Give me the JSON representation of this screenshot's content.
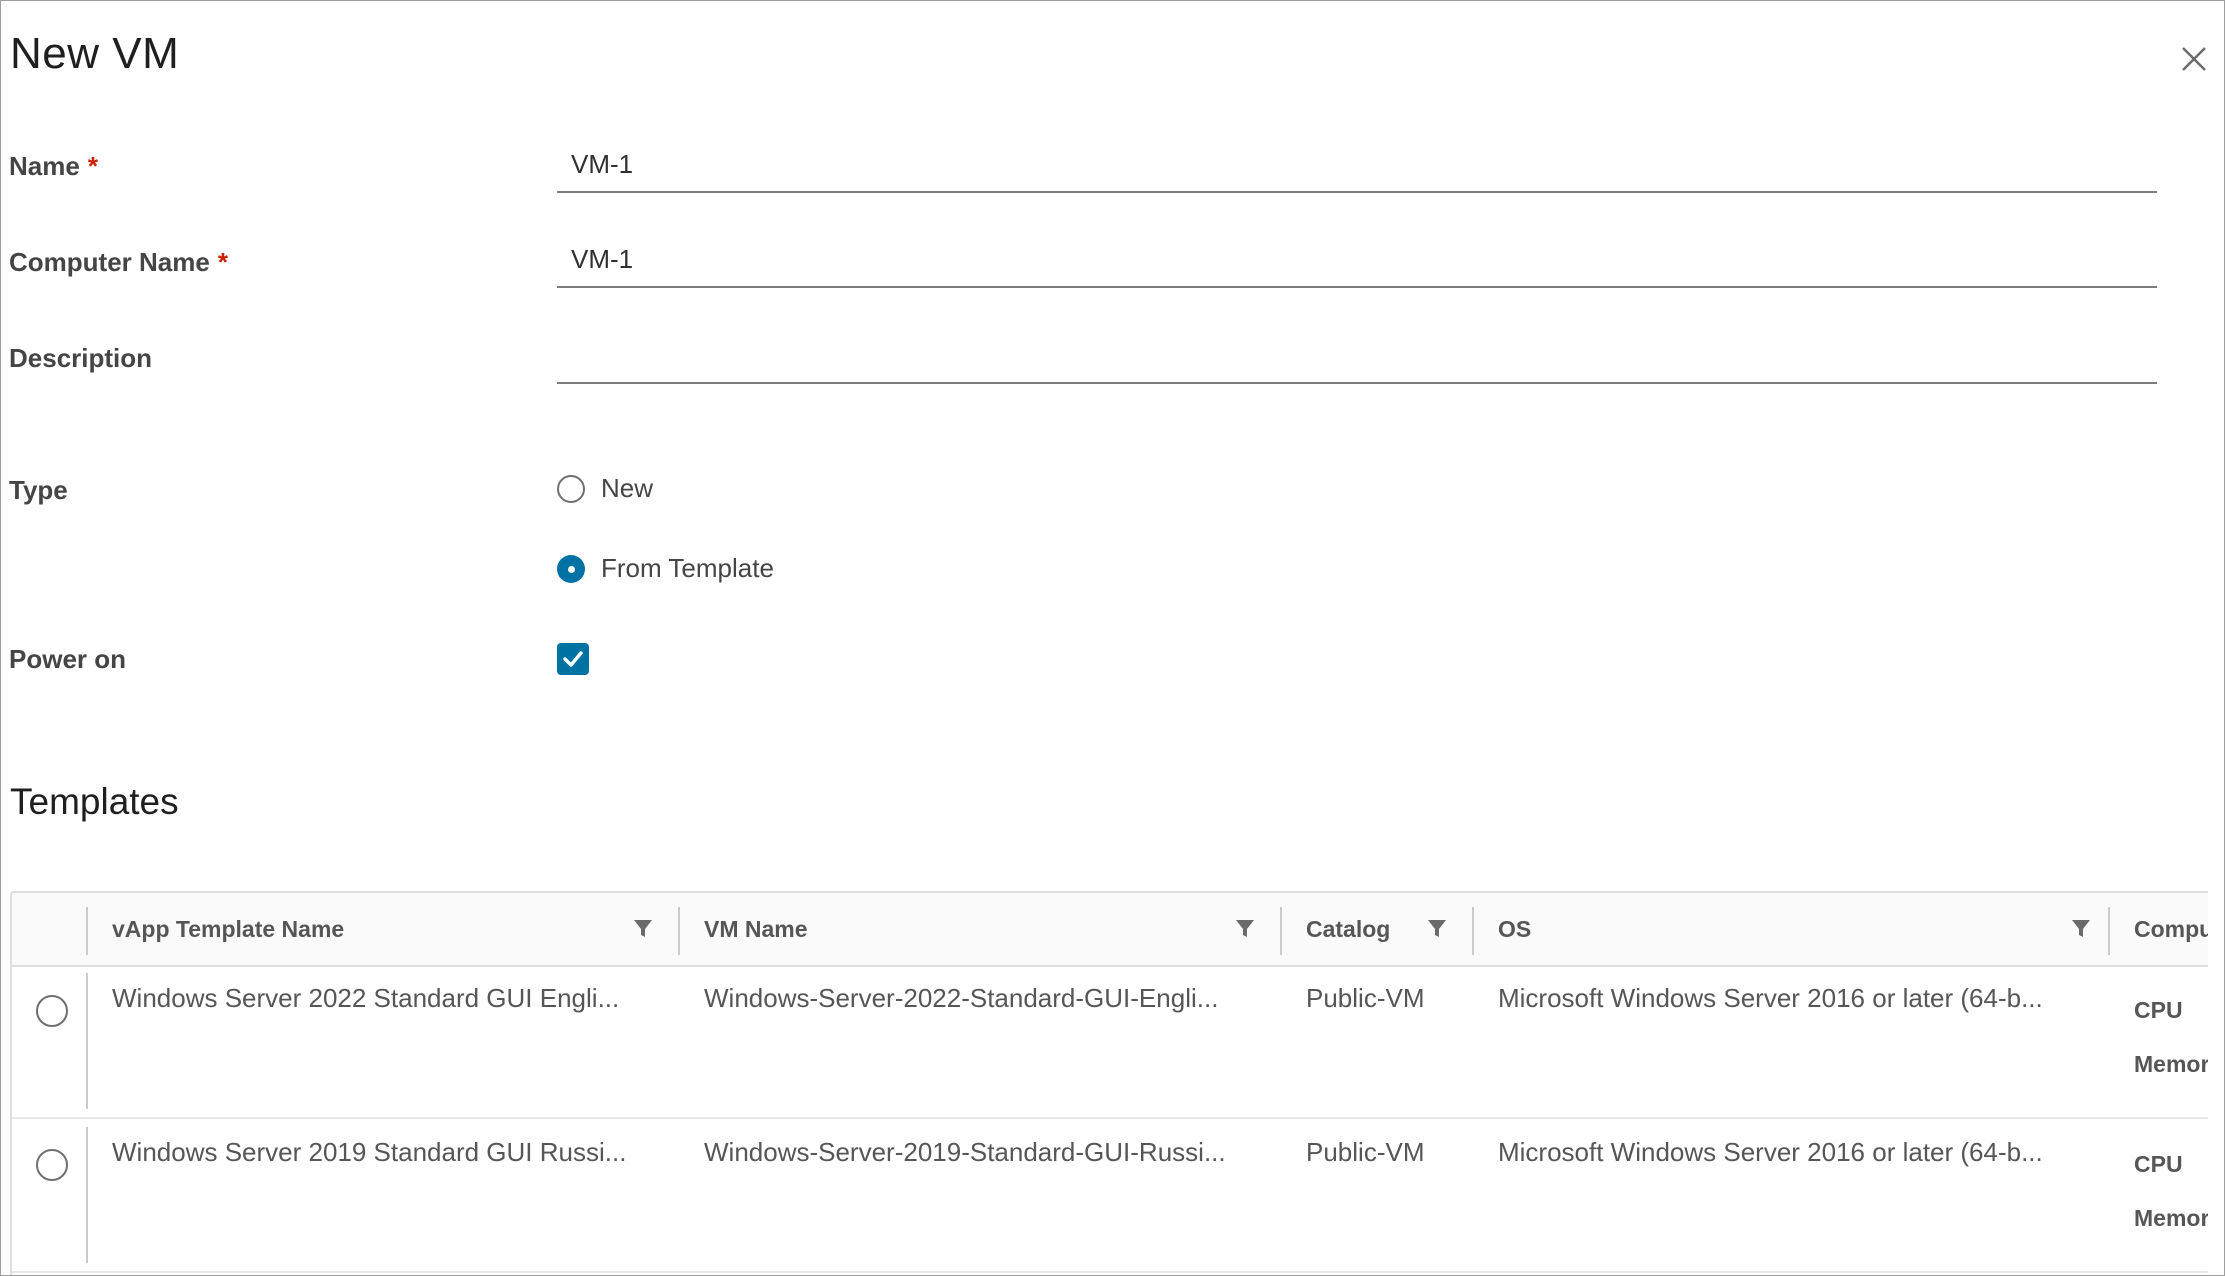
{
  "dialog": {
    "title": "New VM",
    "close_icon": "close-icon"
  },
  "form": {
    "name": {
      "label": "Name",
      "required": "*",
      "value": "VM-1"
    },
    "computer_name": {
      "label": "Computer Name",
      "required": "*",
      "value": "VM-1"
    },
    "description": {
      "label": "Description",
      "value": ""
    },
    "type": {
      "label": "Type",
      "options": [
        {
          "label": "New",
          "selected": false
        },
        {
          "label": "From Template",
          "selected": true
        }
      ]
    },
    "power_on": {
      "label": "Power on",
      "checked": true
    }
  },
  "templates": {
    "title": "Templates",
    "columns": [
      {
        "label": "vApp Template Name",
        "filter_icon": "filter-icon"
      },
      {
        "label": "VM Name",
        "filter_icon": "filter-icon"
      },
      {
        "label": "Catalog",
        "filter_icon": "filter-icon"
      },
      {
        "label": "OS",
        "filter_icon": "filter-icon"
      },
      {
        "label": "Compu"
      }
    ],
    "rows": [
      {
        "vapp_template_name": "Windows Server 2022 Standard GUI Engli...",
        "vm_name": "Windows-Server-2022-Standard-GUI-Engli...",
        "catalog": "Public-VM",
        "os": "Microsoft Windows Server 2016 or later (64-b...",
        "compute_cpu": "CPU",
        "compute_memory": "Memor"
      },
      {
        "vapp_template_name": "Windows Server 2019 Standard GUI Russi...",
        "vm_name": "Windows-Server-2019-Standard-GUI-Russi...",
        "catalog": "Public-VM",
        "os": "Microsoft Windows Server 2016 or later (64-b...",
        "compute_cpu": "CPU",
        "compute_memory": "Memor"
      }
    ]
  },
  "colors": {
    "accent": "#0072a3",
    "required": "#c92100"
  }
}
